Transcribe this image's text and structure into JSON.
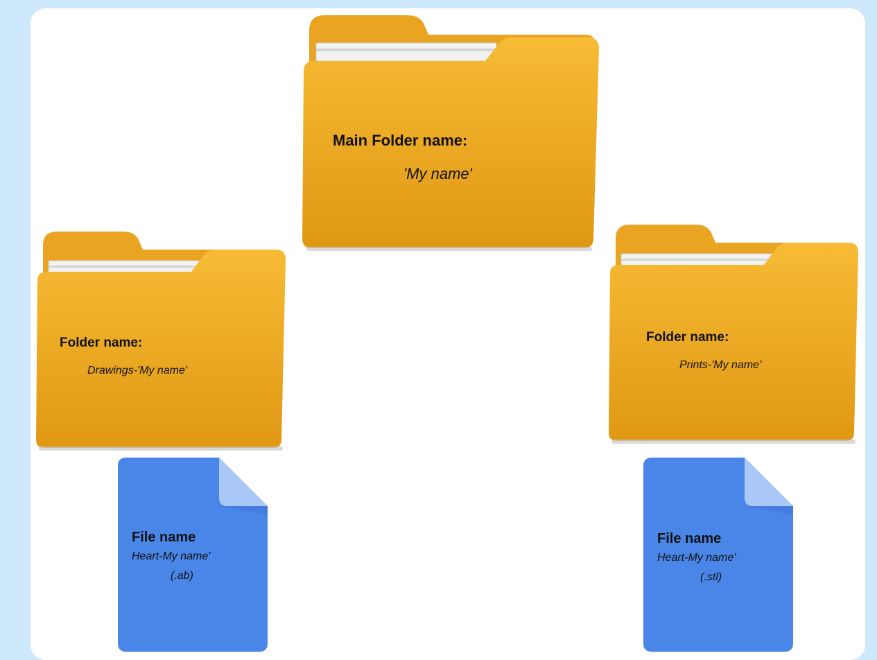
{
  "colors": {
    "page_background": "#cde8fb",
    "panel": "#ffffff",
    "folder_top": "#f6b62e",
    "folder_bottom": "#e29a14",
    "file_blue": "#4a86e8",
    "file_corner": "#a9c8f7"
  },
  "icons": {
    "folder": "folder-icon",
    "file": "document-icon"
  },
  "main_folder": {
    "title": "Main Folder name:",
    "name": "'My name'"
  },
  "left_folder": {
    "title": "Folder name:",
    "name": "Drawings-'My name'"
  },
  "right_folder": {
    "title": "Folder name:",
    "name": "Prints-'My name'"
  },
  "left_file": {
    "title": "File name",
    "name": "Heart-My name'",
    "extension": "(.ab)"
  },
  "right_file": {
    "title": "File name",
    "name": "Heart-My name'",
    "extension": "(.stl)"
  }
}
